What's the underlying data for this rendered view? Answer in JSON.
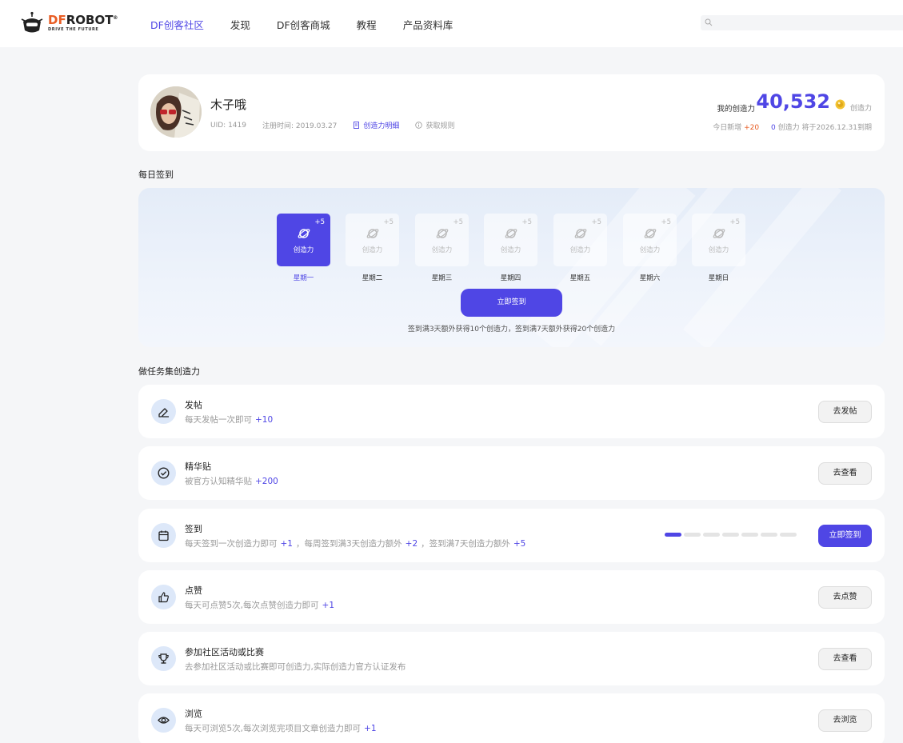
{
  "header": {
    "logo_df": "DF",
    "logo_robot": "ROBOT",
    "logo_mark": "®",
    "logo_tagline": "DRIVE THE FUTURE",
    "nav": [
      {
        "label": "DF创客社区",
        "active": true
      },
      {
        "label": "发现",
        "active": false
      },
      {
        "label": "DF创客商城",
        "active": false
      },
      {
        "label": "教程",
        "active": false
      },
      {
        "label": "产品资料库",
        "active": false
      }
    ],
    "search_placeholder": ""
  },
  "profile": {
    "name": "木子哦",
    "uid": "UID: 1419",
    "register": "注册时间: 2019.03.27",
    "detail_link": "创造力明细",
    "rules_link": "获取规则",
    "cred_label": "我的创造力",
    "cred_value": "40,532",
    "cred_unit": "创造力",
    "today_label": "今日新增",
    "today_plus": "+20",
    "expire_zero": "0",
    "expire_text": "创造力 将于2026.12.31到期"
  },
  "signin": {
    "title": "每日签到",
    "days": [
      {
        "plus": "+5",
        "label": "创造力",
        "day": "星期一",
        "active": true
      },
      {
        "plus": "+5",
        "label": "创造力",
        "day": "星期二",
        "active": false
      },
      {
        "plus": "+5",
        "label": "创造力",
        "day": "星期三",
        "active": false
      },
      {
        "plus": "+5",
        "label": "创造力",
        "day": "星期四",
        "active": false
      },
      {
        "plus": "+5",
        "label": "创造力",
        "day": "星期五",
        "active": false
      },
      {
        "plus": "+5",
        "label": "创造力",
        "day": "星期六",
        "active": false
      },
      {
        "plus": "+5",
        "label": "创造力",
        "day": "星期日",
        "active": false
      }
    ],
    "button": "立即签到",
    "note": "签到满3天额外获得10个创造力，签到满7天额外获得20个创造力"
  },
  "tasks": {
    "title": "做任务集创造力",
    "items": [
      {
        "name": "发帖",
        "icon": "pencil-icon",
        "desc": [
          {
            "t": "每天发帖一次即可"
          },
          {
            "n": "+10"
          }
        ],
        "button": "去发帖",
        "primary": false
      },
      {
        "name": "精华贴",
        "icon": "check-circle-icon",
        "desc": [
          {
            "t": "被官方认知精华贴"
          },
          {
            "n": "+200"
          }
        ],
        "button": "去查看",
        "primary": false
      },
      {
        "name": "签到",
        "icon": "calendar-icon",
        "desc": [
          {
            "t": "每天签到一次创造力即可"
          },
          {
            "n": "+1"
          },
          {
            "t": "，每周签到满3天创造力额外"
          },
          {
            "n": "+2"
          },
          {
            "t": "，签到满7天创造力额外"
          },
          {
            "n": "+5"
          }
        ],
        "button": "立即签到",
        "primary": true,
        "progress": {
          "done": 1,
          "total": 7
        }
      },
      {
        "name": "点赞",
        "icon": "thumbs-up-icon",
        "desc": [
          {
            "t": "每天可点赞5次,每次点赞创造力即可"
          },
          {
            "n": "+1"
          }
        ],
        "button": "去点赞",
        "primary": false
      },
      {
        "name": "参加社区活动或比赛",
        "icon": "trophy-icon",
        "desc": [
          {
            "t": "去参加社区活动或比赛即可创造力,实际创造力官方认证发布"
          }
        ],
        "button": "去查看",
        "primary": false
      },
      {
        "name": "浏览",
        "icon": "eye-icon",
        "desc": [
          {
            "t": "每天可浏览5次,每次浏览完项目文章创造力即可"
          },
          {
            "n": "+1"
          }
        ],
        "button": "去浏览",
        "primary": false
      }
    ]
  },
  "colors": {
    "accent": "#4f46e5",
    "brand_orange": "#e85d24"
  }
}
